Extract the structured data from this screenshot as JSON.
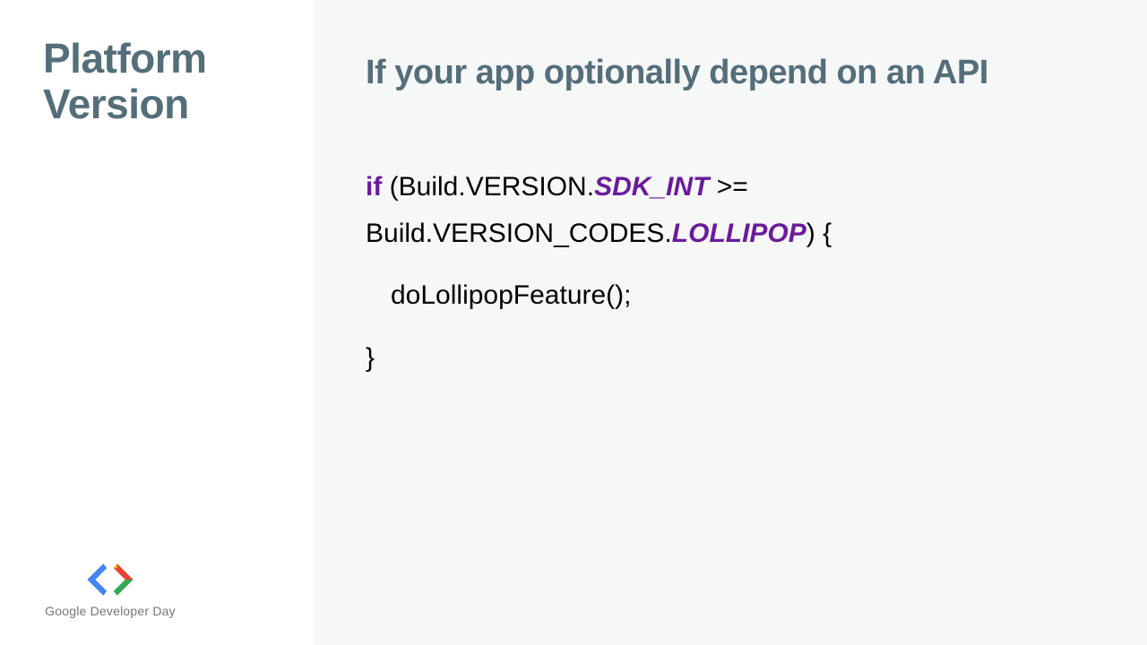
{
  "left": {
    "title_line1": "Platform",
    "title_line2": "Version",
    "branding": {
      "prefix": "Google",
      "suffix": " Developer Day"
    }
  },
  "main": {
    "headline": "If your app optionally depend on an API",
    "code": {
      "kw_if": "if",
      "l1_a": " (Build.VERSION.",
      "const_sdk": "SDK_INT",
      "l1_b": " >=",
      "l2_a": "Build.VERSION_CODES.",
      "const_loll": "LOLLIPOP",
      "l2_b": ") {",
      "l3": "doLollipopFeature();",
      "l4": "}"
    }
  }
}
